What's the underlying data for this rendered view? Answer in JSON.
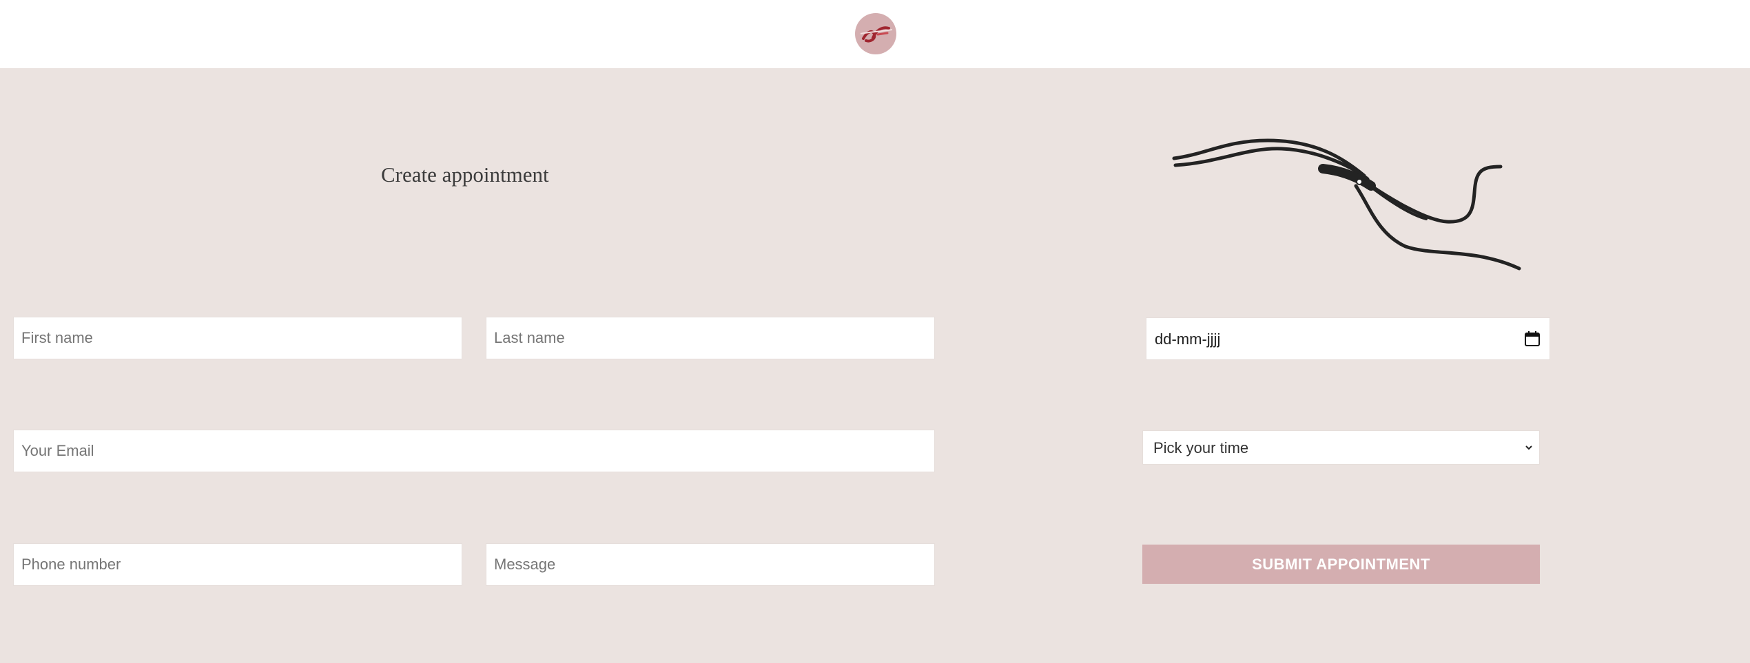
{
  "header": {
    "logo_icon": "brand-logo-icon",
    "logo_colors": {
      "background": "#d4aeb0",
      "mark": "#a02630"
    }
  },
  "form": {
    "title": "Create appointment",
    "first_name_placeholder": "First name",
    "last_name_placeholder": "Last name",
    "email_placeholder": "Your Email",
    "phone_placeholder": "Phone number",
    "message_placeholder": "Message",
    "date_value": "dd-mm-jjjj",
    "date_icon": "calendar-icon",
    "time_select_value": "Pick your time",
    "time_select_icon": "chevron-down-icon",
    "submit_label": "SUBMIT APPOINTMENT"
  },
  "decoration": {
    "icon": "hair-strand-line-art"
  },
  "colors": {
    "page_background": "#ebe3e0",
    "accent": "#d4aeb0",
    "text": "#3c3c3c"
  }
}
